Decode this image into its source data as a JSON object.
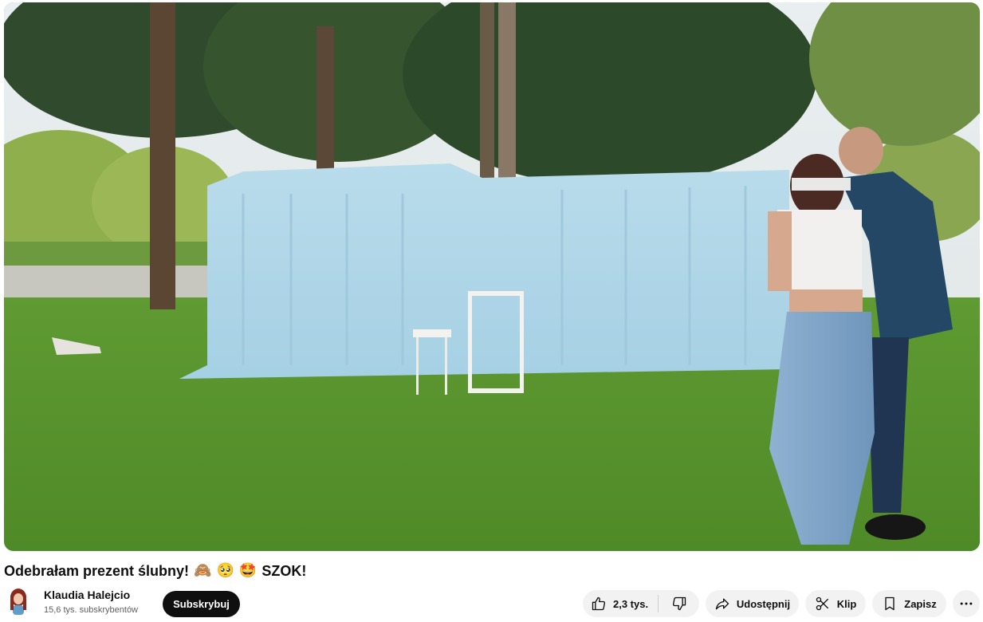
{
  "video": {
    "title": "Odebrałam prezent ślubny!",
    "title_emojis": [
      "🙈",
      "🥺",
      "🤩"
    ],
    "title_suffix": "SZOK!"
  },
  "channel": {
    "name": "Klaudia Halejcio",
    "subscribers": "15,6 tys. subskrybentów",
    "subscribe_label": "Subskrybuj"
  },
  "actions": {
    "like_count": "2,3 tys.",
    "share_label": "Udostępnij",
    "clip_label": "Klip",
    "save_label": "Zapisz"
  },
  "icons": {
    "like": "thumb-up-icon",
    "dislike": "thumb-down-icon",
    "share": "share-arrow-icon",
    "clip": "scissors-icon",
    "save": "bookmark-icon",
    "more": "more-horizontal-icon"
  },
  "colors": {
    "subscribe_bg": "#0f0f0f",
    "pill_bg": "#f2f2f2",
    "secondary_text": "#606060"
  }
}
